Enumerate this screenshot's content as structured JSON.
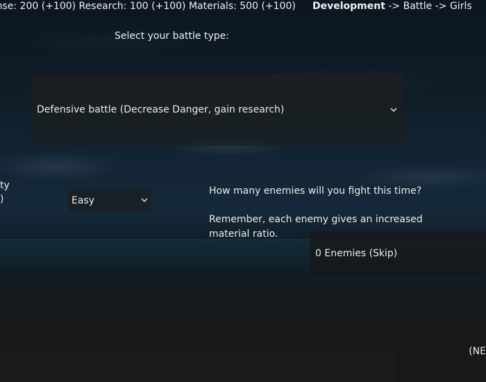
{
  "header": {
    "resources": "ense: 200 (+100) Research: 100 (+100) Materials: 500 (+100)",
    "breadcrumb": {
      "current": "Development",
      "rest": " -> Battle -> Girls"
    }
  },
  "battle_type": {
    "label": "Select your battle type:",
    "selected": "Defensive battle (Decrease Danger, gain research)"
  },
  "difficulty": {
    "label_partial_1": "ty",
    "label_partial_2": ")",
    "selected": "Easy"
  },
  "enemies": {
    "question": "How many enemies will you fight this time?",
    "note_line1": "Remember, each enemy gives an increased",
    "note_line2": "material ratio.",
    "button_label": "0 Enemies (Skip)"
  },
  "next_button": {
    "label": "(NE"
  },
  "icons": {
    "dropdown": "chevron-down-icon"
  }
}
